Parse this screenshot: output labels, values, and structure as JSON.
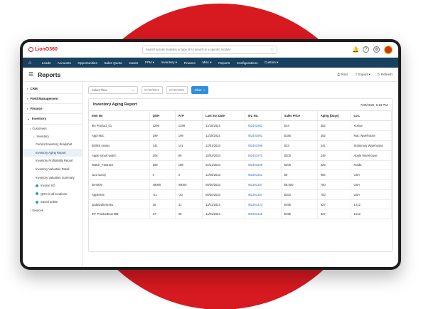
{
  "app": {
    "logo_text": "LionO360"
  },
  "search": {
    "placeholder": "Search across modules or type @ to search in a specific module"
  },
  "nav": {
    "items": [
      "Leads",
      "Accounts",
      "Opportunities",
      "Sales Quota",
      "Cases",
      "FFM ▾",
      "Inventory ▾",
      "Finance",
      "Misc ▾",
      "Reports",
      "Configurations",
      "Custom ▾"
    ]
  },
  "page": {
    "title": "Reports",
    "actions": {
      "print": "Print",
      "export": "Export ▾",
      "refresh": "Refresh"
    }
  },
  "sidebar": {
    "sections": [
      {
        "label": "CRM"
      },
      {
        "label": "Field Management"
      },
      {
        "label": "Finance"
      },
      {
        "label": "Inventory"
      }
    ],
    "customers": "Customers",
    "inventory": "Inventory",
    "inventory_items": [
      "Current Inventory Snapshot",
      "Inventory Aging Report",
      "Inventory Profitability Report",
      "Inventory Valuation Detail",
      "Inventory Valuation Summary"
    ],
    "favorites": [
      "Invoice SO",
      "QOH in all locations",
      "Saved prd09"
    ],
    "invoices": "Invoices"
  },
  "filters": {
    "select_time": "Select Time",
    "date_from": "07/30/2025",
    "date_to": "07/30/2025",
    "filter_label": "Filter"
  },
  "report": {
    "title": "Inventory Aging Report",
    "timestamp": "7/30/2025, 6:18 PM",
    "columns": [
      "Item No",
      "QOH",
      "ATP",
      "Last Inv. Date",
      "Inv. No.",
      "Sales Price",
      "Aging (Days)",
      "Loc."
    ],
    "rows": [
      [
        "8in Product_01",
        "1298",
        "1298",
        "11/20/2024",
        "IN2401963",
        "$44",
        "252",
        "Kumar"
      ],
      [
        "Appl Mac",
        "199",
        "199",
        "11/20/2024",
        "IN2401961",
        "$185",
        "252",
        "Mac Warehouse"
      ],
      [
        "BOMS eraser",
        "141",
        "141",
        "12/01/2024",
        "IN2401996",
        "$33",
        "241",
        "Stationary Warehouse"
      ],
      [
        "Apple smart watch",
        "106",
        "99",
        "10/02/2024",
        "IN2401970",
        "$300",
        "249",
        "Apple Warehouse"
      ],
      [
        "Watch_Fastrack",
        "189",
        "189",
        "02/21/2024",
        "IN2401939",
        "$200",
        "525",
        "Noida"
      ],
      [
        "i123 surraj",
        "0",
        "0",
        "12/05/2023",
        "IN2301351",
        "$0",
        "964",
        "USA"
      ],
      [
        "item000",
        "49000",
        "49000",
        "08/30/2023",
        "IN2301357",
        "$6,500",
        "700",
        "USA"
      ],
      [
        "Apple045",
        "-21",
        "-23",
        "08/30/2023",
        "IN2301357",
        "$200",
        "700",
        "USA"
      ],
      [
        "updatedItem461",
        "35",
        "31",
        "11/01/2023",
        "IN2301423",
        "$495",
        "627",
        "1212"
      ],
      [
        "IKF ProductEvent69",
        "37",
        "30",
        "11/01/2023",
        "IN2301425",
        "$495",
        "627",
        "1212"
      ]
    ]
  }
}
